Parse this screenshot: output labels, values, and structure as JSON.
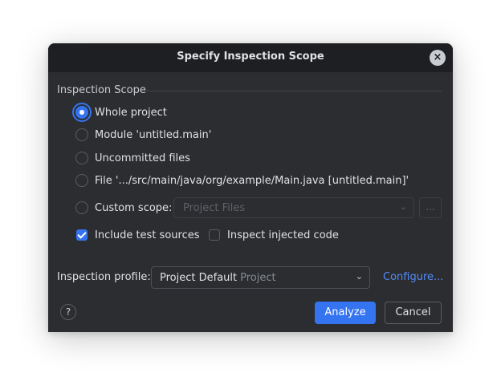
{
  "dialog": {
    "title": "Specify Inspection Scope",
    "close_icon": "close-icon",
    "close_glyph": "×"
  },
  "scope": {
    "group_title": "Inspection Scope",
    "options": [
      {
        "label": "Whole project",
        "selected": true
      },
      {
        "label": "Module 'untitled.main'",
        "selected": false
      },
      {
        "label": "Uncommitted files",
        "selected": false
      },
      {
        "label": "File '.../src/main/java/org/example/Main.java [untitled.main]'",
        "selected": false
      },
      {
        "label": "Custom scope:",
        "selected": false
      }
    ],
    "custom_scope_placeholder": "Project Files",
    "custom_scope_browse": "...",
    "include_test_sources": {
      "label": "Include test sources",
      "checked": true
    },
    "inspect_injected_code": {
      "label": "Inspect injected code",
      "checked": false
    }
  },
  "profile": {
    "label": "Inspection profile:",
    "value": "Project Default",
    "value_sub": "Project",
    "configure_link": "Configure..."
  },
  "footer": {
    "help": "?",
    "analyze": "Analyze",
    "cancel": "Cancel"
  },
  "colors": {
    "background": "#2b2d30",
    "title_bar": "#1e1f22",
    "accent": "#3574f0",
    "link": "#548af7"
  }
}
